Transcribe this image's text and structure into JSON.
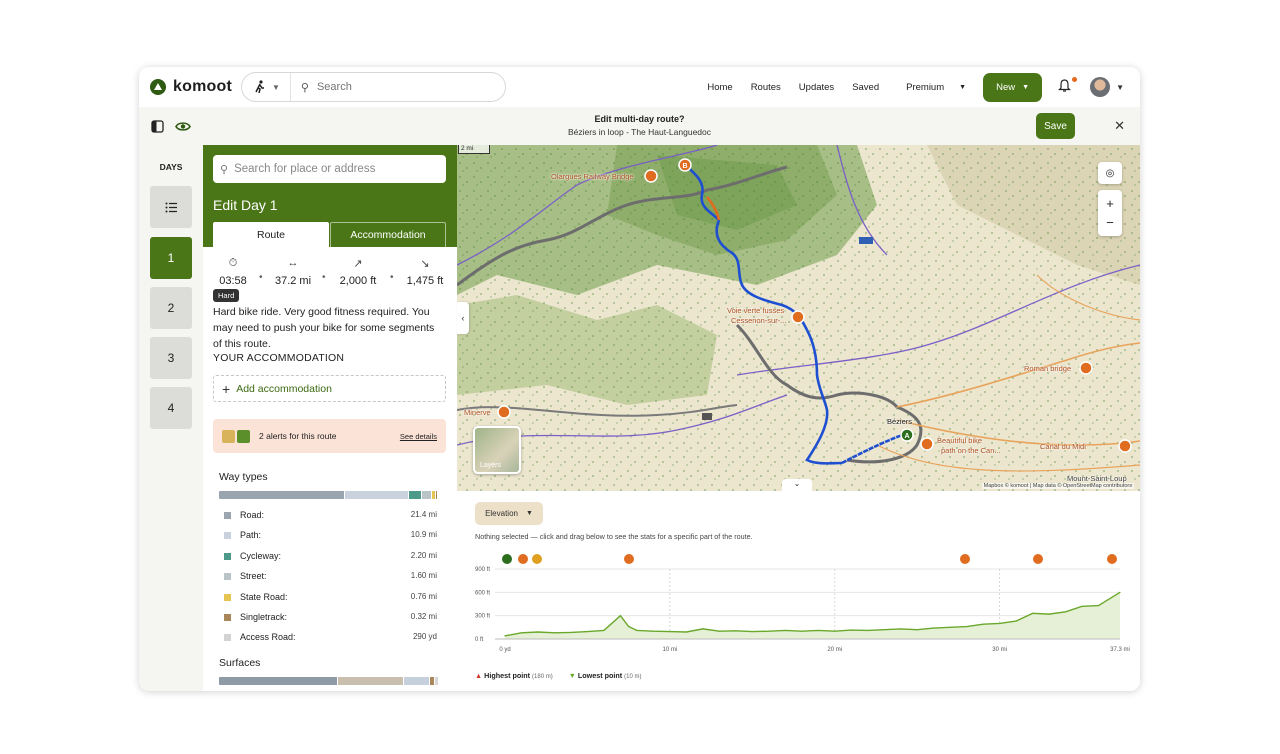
{
  "header": {
    "logo_text": "komoot",
    "search_placeholder": "Search",
    "nav": [
      "Home",
      "Routes",
      "Updates",
      "Saved"
    ],
    "premium_label": "Premium",
    "new_label": "New"
  },
  "subbar": {
    "title": "Edit multi-day route?",
    "subtitle": "Béziers in loop - The Haut-Languedoc",
    "save_label": "Save"
  },
  "days": {
    "title": "DAYS",
    "items": [
      "1",
      "2",
      "3",
      "4"
    ],
    "active": "1"
  },
  "panel": {
    "search_placeholder": "Search for place or address",
    "title": "Edit Day 1",
    "tabs": [
      "Route",
      "Accommodation"
    ],
    "stats": {
      "duration": "03:58",
      "distance": "37.2 mi",
      "uphill": "2,000 ft",
      "downhill": "1,475 ft"
    },
    "difficulty_badge": "Hard",
    "description": "Hard bike ride. Very good fitness required. You may need to push your bike for some segments of this route.",
    "accommodation_heading": "YOUR ACCOMMODATION",
    "add_accommodation": "Add accommodation",
    "alerts_text": "2 alerts for this route",
    "alerts_link": "See details",
    "way_types_title": "Way types",
    "way_types": [
      {
        "label": "Road:",
        "value": "21.4 mi",
        "color": "#9aa5b0"
      },
      {
        "label": "Path:",
        "value": "10.9 mi",
        "color": "#c9d1dc"
      },
      {
        "label": "Cycleway:",
        "value": "2.20 mi",
        "color": "#4e9a8a"
      },
      {
        "label": "Street:",
        "value": "1.60 mi",
        "color": "#b8c4c8"
      },
      {
        "label": "State Road:",
        "value": "0.76 mi",
        "color": "#e6c452"
      },
      {
        "label": "Singletrack:",
        "value": "0.32 mi",
        "color": "#a8865a"
      },
      {
        "label": "Access Road:",
        "value": "290 yd",
        "color": "#d3d3d3"
      }
    ],
    "surfaces_title": "Surfaces",
    "surfaces_bar": [
      {
        "color": "#8e9aa6",
        "share": 0.54
      },
      {
        "color": "#c9bfae",
        "share": 0.3
      },
      {
        "color": "#c6d0dc",
        "share": 0.12
      },
      {
        "color": "#a8865a",
        "share": 0.02
      },
      {
        "color": "#d8d8d8",
        "share": 0.02
      }
    ]
  },
  "map": {
    "scale_label": "2 mi",
    "layers_label": "Layers",
    "attribution": "Mapbox © komoot | Map data © OpenStreetMap contributors",
    "labels": {
      "olargues": "Olargues Railway Bridge",
      "voie": "Voie verte fusses",
      "voie2": "Cessenon-sur-...",
      "minerve": "Minerve",
      "roman": "Roman bridge",
      "beziers": "Béziers",
      "beautiful": "Beautiful bike",
      "beautiful2": "path on the Can...",
      "canal": "Canal du Midi",
      "mont": "Mount-Saint-Loup"
    }
  },
  "elevation": {
    "button_label": "Elevation",
    "note": "Nothing selected — click and drag below to see the stats for a specific part of the route.",
    "highest_label": "Highest point",
    "highest_value": "(180 m)",
    "lowest_label": "Lowest point",
    "lowest_value": "(10 m)"
  },
  "chart_data": {
    "type": "area",
    "x_ticks": [
      "0 yd",
      "10 mi",
      "20 mi",
      "30 mi",
      "37.3 mi"
    ],
    "y_ticks": [
      "0 ft",
      "300 ft",
      "600 ft",
      "900 ft"
    ],
    "xlim": [
      0,
      37.3
    ],
    "ylim": [
      0,
      900
    ],
    "x": [
      0,
      1,
      2,
      3,
      4,
      5,
      6,
      7,
      7.5,
      8,
      9,
      10,
      11,
      12,
      13,
      14,
      15,
      16,
      17,
      18,
      19,
      20,
      21,
      22,
      23,
      24,
      25,
      26,
      27,
      28,
      29,
      30,
      31,
      32,
      33,
      34,
      35,
      36,
      37.3
    ],
    "y": [
      40,
      80,
      90,
      80,
      85,
      95,
      110,
      300,
      160,
      110,
      100,
      95,
      90,
      130,
      100,
      105,
      95,
      100,
      110,
      100,
      110,
      100,
      115,
      110,
      120,
      130,
      120,
      140,
      150,
      160,
      190,
      200,
      230,
      330,
      320,
      350,
      420,
      430,
      600
    ],
    "series_color": "#6aa82c",
    "grid": true
  }
}
